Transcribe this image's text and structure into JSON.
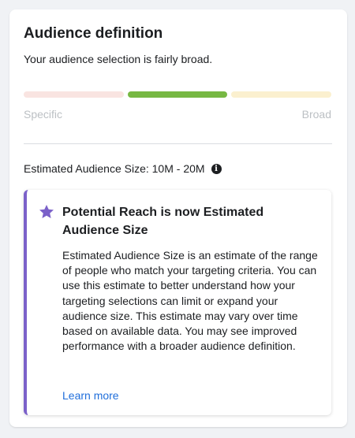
{
  "card": {
    "title": "Audience definition",
    "subtitle": "Your audience selection is fairly broad.",
    "meter": {
      "left_label": "Specific",
      "right_label": "Broad",
      "active_segment": 2,
      "segment_count": 3,
      "colors": {
        "specific": "#f9e4e1",
        "active": "#77b843",
        "broad": "#fbf0cf"
      }
    },
    "estimate_label": "Estimated Audience Size: 10M - 20M",
    "info_icon": "info-icon"
  },
  "notice": {
    "icon": "star-icon",
    "accent_color": "#7b61c9",
    "title": "Potential Reach is now Estimated Audience Size",
    "body": "Estimated Audience Size is an estimate of the range of people who match your targeting criteria. You can use this estimate to better understand how your targeting selections can limit or expand your audience size. This estimate may vary over time based on available data. You may see improved performance with a broader audience definition.",
    "link": "Learn more",
    "link_color": "#216fdb"
  }
}
